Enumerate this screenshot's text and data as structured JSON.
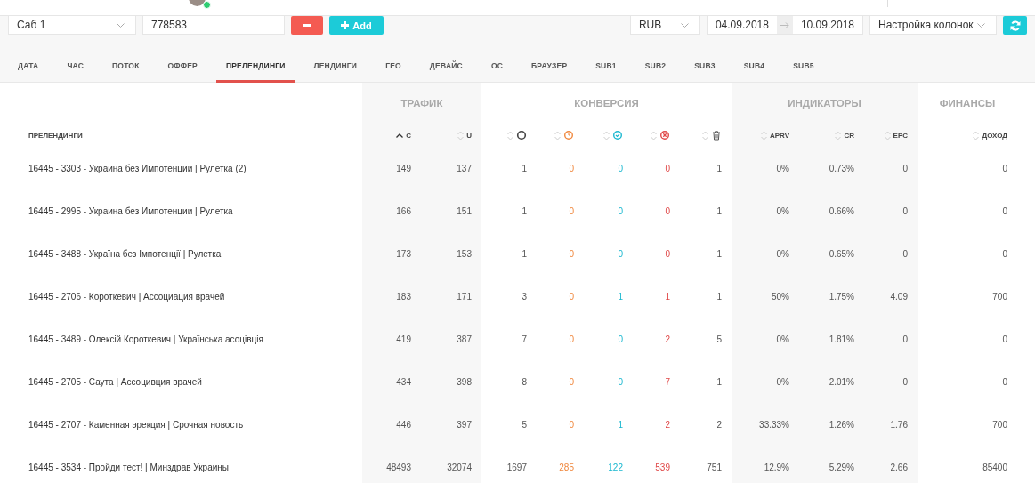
{
  "top_bar": {
    "manager_online": true
  },
  "filters": {
    "sub_select": "Саб 1",
    "sub_value": "778583",
    "add_button": "Add",
    "currency": "RUB",
    "date_from": "04.09.2018",
    "date_to": "10.09.2018",
    "columns_select": "Настройка колонок"
  },
  "tabs": [
    {
      "label": "ДАТА",
      "selected": false
    },
    {
      "label": "ЧАС",
      "selected": false
    },
    {
      "label": "ПОТОК",
      "selected": false
    },
    {
      "label": "ОФФЕР",
      "selected": false
    },
    {
      "label": "ПРЕЛЕНДИНГИ",
      "selected": true
    },
    {
      "label": "ЛЕНДИНГИ",
      "selected": false
    },
    {
      "label": "ГЕО",
      "selected": false
    },
    {
      "label": "ДЕВАЙС",
      "selected": false
    },
    {
      "label": "ОС",
      "selected": false
    },
    {
      "label": "БРАУЗЕР",
      "selected": false
    },
    {
      "label": "SUB1",
      "selected": false
    },
    {
      "label": "SUB2",
      "selected": false
    },
    {
      "label": "SUB3",
      "selected": false
    },
    {
      "label": "SUB4",
      "selected": false
    },
    {
      "label": "SUB5",
      "selected": false
    }
  ],
  "table": {
    "name_column": "ПРЕЛЕНДИНГИ",
    "groups": [
      {
        "label": "ТРАФИК",
        "columns": [
          {
            "kind": "text",
            "label": "C",
            "sorted": true
          },
          {
            "kind": "text",
            "label": "U",
            "sorted": false
          }
        ]
      },
      {
        "label": "КОНВЕРСИЯ",
        "columns": [
          {
            "kind": "total",
            "sorted": false
          },
          {
            "kind": "pending",
            "sorted": false
          },
          {
            "kind": "approved",
            "sorted": false
          },
          {
            "kind": "rejected",
            "sorted": false
          },
          {
            "kind": "trash",
            "sorted": false
          }
        ]
      },
      {
        "label": "ИНДИКАТОРЫ",
        "columns": [
          {
            "kind": "text",
            "label": "APRV",
            "sorted": false
          },
          {
            "kind": "text",
            "label": "CR",
            "sorted": false
          },
          {
            "kind": "text",
            "label": "EPC",
            "sorted": false
          }
        ]
      },
      {
        "label": "ФИНАНСЫ",
        "columns": [
          {
            "kind": "text",
            "label": "ДОХОД",
            "sorted": false
          }
        ]
      }
    ],
    "rows": [
      {
        "name": "16445 - 3303 - Украина без Импотенции | Рулетка (2)",
        "values": [
          "149",
          "137",
          "1",
          "0",
          "0",
          "0",
          "1",
          "0%",
          "0.73%",
          "0",
          "0"
        ]
      },
      {
        "name": "16445 - 2995 - Украина без Импотенции | Рулетка",
        "values": [
          "166",
          "151",
          "1",
          "0",
          "0",
          "0",
          "1",
          "0%",
          "0.66%",
          "0",
          "0"
        ]
      },
      {
        "name": "16445 - 3488 - Україна без Імпотенції | Рулетка",
        "values": [
          "173",
          "153",
          "1",
          "0",
          "0",
          "0",
          "1",
          "0%",
          "0.65%",
          "0",
          "0"
        ]
      },
      {
        "name": "16445 - 2706 - Короткевич | Ассоциация врачей",
        "values": [
          "183",
          "171",
          "3",
          "0",
          "1",
          "1",
          "1",
          "50%",
          "1.75%",
          "4.09",
          "700"
        ]
      },
      {
        "name": "16445 - 3489 - Олексій Короткевич | Українська асоцівція",
        "values": [
          "419",
          "387",
          "7",
          "0",
          "0",
          "2",
          "5",
          "0%",
          "1.81%",
          "0",
          "0"
        ]
      },
      {
        "name": "16445 - 2705 - Саута | Ассоцивция врачей",
        "values": [
          "434",
          "398",
          "8",
          "0",
          "0",
          "7",
          "1",
          "0%",
          "2.01%",
          "0",
          "0"
        ]
      },
      {
        "name": "16445 - 2707 - Каменная эрекция | Срочная новость",
        "values": [
          "446",
          "397",
          "5",
          "0",
          "1",
          "2",
          "2",
          "33.33%",
          "1.26%",
          "1.76",
          "700"
        ]
      },
      {
        "name": "16445 - 3534 - Пройди тест! | Минздрав Украины",
        "values": [
          "48493",
          "32074",
          "1697",
          "285",
          "122",
          "539",
          "751",
          "12.9%",
          "5.29%",
          "2.66",
          "85400"
        ]
      }
    ]
  }
}
